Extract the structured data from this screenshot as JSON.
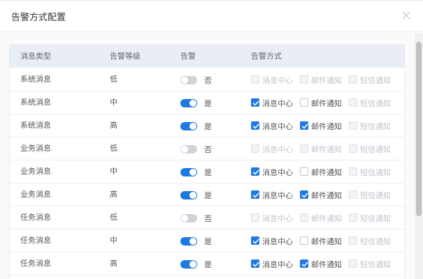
{
  "dialog": {
    "title": "告警方式配置"
  },
  "table": {
    "headers": [
      "消息类型",
      "告警等级",
      "告警",
      "告警方式"
    ],
    "rows": [
      {
        "type": "系统消息",
        "level": "低",
        "alarm_on": false,
        "alarm_label": "否",
        "methods": [
          {
            "label": "消息中心",
            "checked": false,
            "disabled": true
          },
          {
            "label": "邮件通知",
            "checked": false,
            "disabled": true
          },
          {
            "label": "短信通知",
            "checked": false,
            "disabled": true
          }
        ]
      },
      {
        "type": "系统消息",
        "level": "中",
        "alarm_on": true,
        "alarm_label": "是",
        "methods": [
          {
            "label": "消息中心",
            "checked": true,
            "disabled": false
          },
          {
            "label": "邮件通知",
            "checked": false,
            "disabled": false
          },
          {
            "label": "短信通知",
            "checked": false,
            "disabled": true
          }
        ]
      },
      {
        "type": "系统消息",
        "level": "高",
        "alarm_on": true,
        "alarm_label": "是",
        "methods": [
          {
            "label": "消息中心",
            "checked": true,
            "disabled": false
          },
          {
            "label": "邮件通知",
            "checked": true,
            "disabled": false
          },
          {
            "label": "短信通知",
            "checked": false,
            "disabled": true
          }
        ]
      },
      {
        "type": "业务消息",
        "level": "低",
        "alarm_on": false,
        "alarm_label": "否",
        "methods": [
          {
            "label": "消息中心",
            "checked": false,
            "disabled": true
          },
          {
            "label": "邮件通知",
            "checked": false,
            "disabled": true
          },
          {
            "label": "短信通知",
            "checked": false,
            "disabled": true
          }
        ]
      },
      {
        "type": "业务消息",
        "level": "中",
        "alarm_on": true,
        "alarm_label": "是",
        "methods": [
          {
            "label": "消息中心",
            "checked": true,
            "disabled": false
          },
          {
            "label": "邮件通知",
            "checked": false,
            "disabled": false
          },
          {
            "label": "短信通知",
            "checked": false,
            "disabled": true
          }
        ]
      },
      {
        "type": "业务消息",
        "level": "高",
        "alarm_on": true,
        "alarm_label": "是",
        "methods": [
          {
            "label": "消息中心",
            "checked": true,
            "disabled": false
          },
          {
            "label": "邮件通知",
            "checked": true,
            "disabled": false
          },
          {
            "label": "短信通知",
            "checked": false,
            "disabled": true
          }
        ]
      },
      {
        "type": "任务消息",
        "level": "低",
        "alarm_on": false,
        "alarm_label": "否",
        "methods": [
          {
            "label": "消息中心",
            "checked": false,
            "disabled": true
          },
          {
            "label": "邮件通知",
            "checked": false,
            "disabled": true
          },
          {
            "label": "短信通知",
            "checked": false,
            "disabled": true
          }
        ]
      },
      {
        "type": "任务消息",
        "level": "中",
        "alarm_on": true,
        "alarm_label": "是",
        "methods": [
          {
            "label": "消息中心",
            "checked": true,
            "disabled": false
          },
          {
            "label": "邮件通知",
            "checked": false,
            "disabled": false
          },
          {
            "label": "短信通知",
            "checked": false,
            "disabled": true
          }
        ]
      },
      {
        "type": "任务消息",
        "level": "高",
        "alarm_on": true,
        "alarm_label": "是",
        "methods": [
          {
            "label": "消息中心",
            "checked": true,
            "disabled": false
          },
          {
            "label": "邮件通知",
            "checked": true,
            "disabled": false
          },
          {
            "label": "短信通知",
            "checked": false,
            "disabled": true
          }
        ]
      }
    ]
  },
  "icons": {
    "close": "close-icon",
    "check": "check-icon"
  },
  "colors": {
    "accent": "#1f7ae0",
    "header_bg": "#e9edf5",
    "switch_off": "#cfd3d9"
  }
}
